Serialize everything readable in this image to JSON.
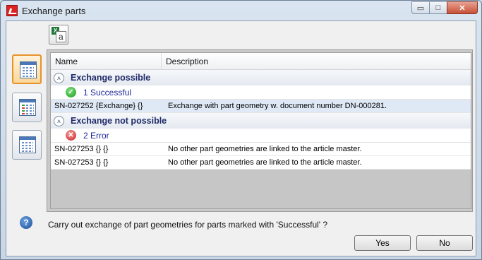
{
  "window": {
    "title": "Exchange parts"
  },
  "titlebar": {
    "minimize": "▭",
    "maximize": "□",
    "close": "✕"
  },
  "toolbar": {
    "excel_x": "X",
    "excel_a": "a"
  },
  "list": {
    "columns": {
      "name": "Name",
      "description": "Description"
    },
    "groups": [
      {
        "label": "Exchange possible",
        "toggle": "˄",
        "status": {
          "label": "1 Successful",
          "icon": "check-icon"
        },
        "rows": [
          {
            "name": "SN-027252 {Exchange} {}",
            "description": "Exchange with part geometry w. document number DN-000281."
          }
        ]
      },
      {
        "label": "Exchange not possible",
        "toggle": "˄",
        "status": {
          "label": "2 Error",
          "icon": "error-icon"
        },
        "rows": [
          {
            "name": "SN-027253 {} {}",
            "description": "No other part geometries are linked to the article master."
          },
          {
            "name": "SN-027253 {} {}",
            "description": "No other part geometries are linked to the article master."
          }
        ]
      }
    ]
  },
  "footer": {
    "help_glyph": "?",
    "question": "Carry out exchange of part geometries for parts marked with  'Successful' ?",
    "yes_label": "Yes",
    "no_label": "No"
  },
  "colors": {
    "accent": "#e8922a",
    "group_text": "#1f2a68",
    "success": "#1c9c1c",
    "error": "#c71f1f"
  }
}
